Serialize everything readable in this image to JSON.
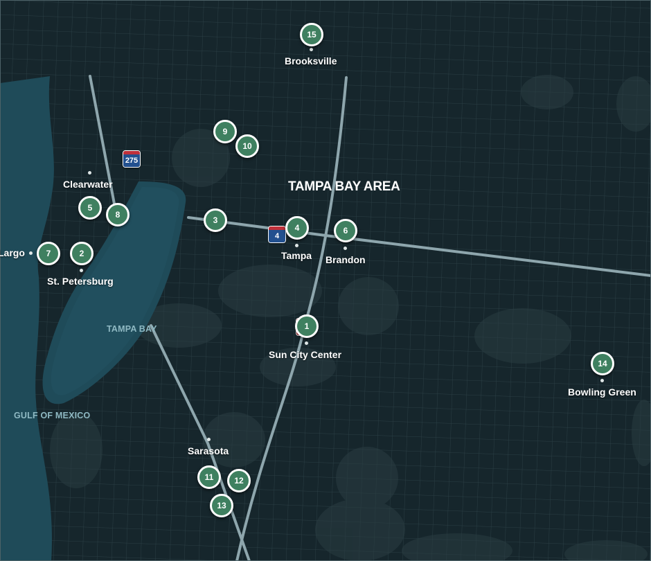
{
  "map": {
    "region_label": "TAMPA BAY AREA",
    "water_labels": {
      "bay": "TAMPA BAY",
      "gulf": "GULF OF MEXICO"
    },
    "colors": {
      "background": "#16262c",
      "water": "#1f4b59",
      "grid": "#35494f",
      "road": "#8ea6ad",
      "marker_fill": "#3f8060",
      "marker_border": "#ffffff",
      "shield_top": "#c0303a",
      "shield_body": "#22508f"
    },
    "cities": [
      {
        "id": "brooksville",
        "name": "Brooksville"
      },
      {
        "id": "clearwater",
        "name": "Clearwater"
      },
      {
        "id": "largo",
        "name": "Largo"
      },
      {
        "id": "st-petersburg",
        "name": "St. Petersburg"
      },
      {
        "id": "tampa",
        "name": "Tampa"
      },
      {
        "id": "brandon",
        "name": "Brandon"
      },
      {
        "id": "sun-city-center",
        "name": "Sun City Center"
      },
      {
        "id": "bowling-green",
        "name": "Bowling Green"
      },
      {
        "id": "sarasota",
        "name": "Sarasota"
      }
    ],
    "markers": [
      "1",
      "2",
      "3",
      "4",
      "5",
      "6",
      "7",
      "8",
      "9",
      "10",
      "11",
      "12",
      "13",
      "14",
      "15"
    ],
    "shields": [
      {
        "id": "i275",
        "number": "275",
        "icon": "interstate-shield-icon"
      },
      {
        "id": "i4",
        "number": "4",
        "icon": "interstate-shield-icon"
      }
    ]
  }
}
